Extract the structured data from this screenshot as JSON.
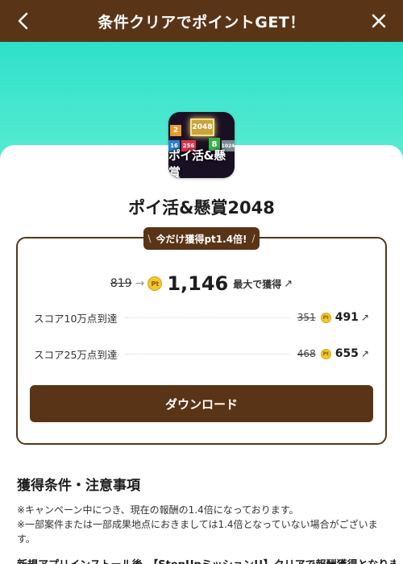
{
  "header": {
    "title": "条件クリアでポイントGET！",
    "back_icon": "chevron-left-icon",
    "close_icon": "close-icon"
  },
  "colors": {
    "brand_brown": "#5a3416",
    "hero_teal": "#2ee0c9",
    "coin_gold": "#f3c632"
  },
  "app": {
    "name": "ポイ活&懸賞2048",
    "icon": {
      "caption": "ポイ活&懸賞",
      "tiles": [
        "2",
        "2048",
        "16",
        "256",
        "8",
        "1024"
      ]
    }
  },
  "offer": {
    "badge": "今だけ獲得pt1.4倍!",
    "badge_slash_left": "\\",
    "badge_slash_right": "/",
    "original_points": "819",
    "arrow": "→",
    "coin_label": "Pt",
    "points": "1,146",
    "max_label": "最大で獲得",
    "external_mark": "↗"
  },
  "tiers": [
    {
      "label": "スコア10万点到達",
      "original": "351",
      "points": "491",
      "external_mark": "↗"
    },
    {
      "label": "スコア25万点到達",
      "original": "468",
      "points": "655",
      "external_mark": "↗"
    }
  ],
  "download_button": "ダウンロード",
  "conditions": {
    "title": "獲得条件・注意事項",
    "notes": [
      "※キャンペーン中につき、現在の報酬の1.4倍になっております。",
      "※一部案件または一部成果地点におきましては1.4倍となっていない場合がございます。"
    ],
    "cut_line": "新規アプリインストール後、【StepUpミッション!!】クリアで報酬獲得となります。"
  }
}
